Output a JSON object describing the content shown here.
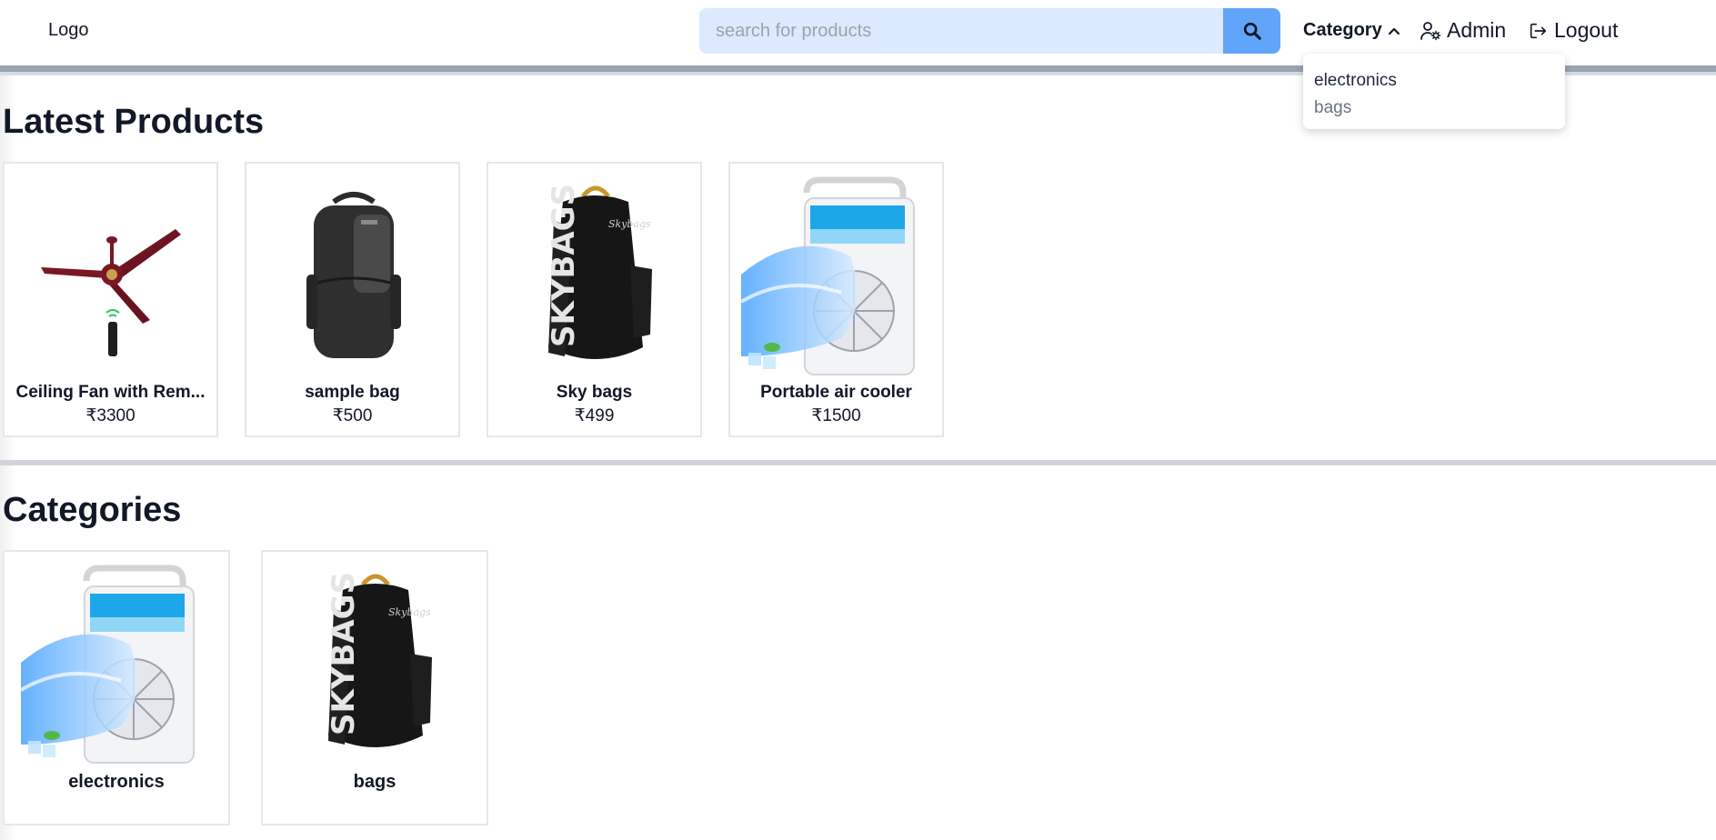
{
  "header": {
    "logo": "Logo",
    "search_placeholder": "search for products",
    "search_value": "",
    "nav": {
      "category": "Category",
      "admin": "Admin",
      "logout": "Logout"
    },
    "category_dropdown": [
      "electronics",
      "bags"
    ]
  },
  "latest": {
    "title": "Latest Products",
    "products": [
      {
        "name": "Ceiling Fan with Rem...",
        "price": "₹3300",
        "image": "ceiling-fan"
      },
      {
        "name": "sample bag",
        "price": "₹500",
        "image": "backpack-plain"
      },
      {
        "name": "Sky bags",
        "price": "₹499",
        "image": "backpack-skybags"
      },
      {
        "name": "Portable air cooler",
        "price": "₹1500",
        "image": "air-cooler"
      }
    ]
  },
  "categories": {
    "title": "Categories",
    "items": [
      {
        "name": "electronics",
        "image": "air-cooler"
      },
      {
        "name": "bags",
        "image": "backpack-skybags"
      }
    ]
  },
  "colors": {
    "search_bg": "#dbeafe",
    "search_button": "#60a5fa",
    "divider": "#9aa3b2",
    "card_border": "#e5e7eb"
  },
  "icons": [
    "search-icon",
    "chevron-up-icon",
    "user-cog-icon",
    "logout-icon"
  ]
}
